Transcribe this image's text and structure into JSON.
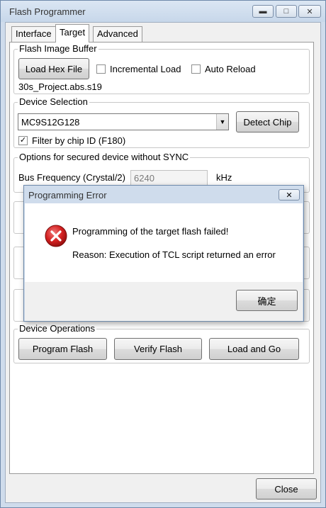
{
  "window": {
    "title": "Flash Programmer",
    "min_icon": "minimize-icon",
    "max_icon": "maximize-icon",
    "close_icon": "close-icon"
  },
  "tabs": [
    "Interface",
    "Target",
    "Advanced"
  ],
  "active_tab": "Target",
  "flash_image_buffer": {
    "title": "Flash Image Buffer",
    "load_hex_label": "Load Hex File",
    "incremental_load_label": "Incremental Load",
    "incremental_load_checked": false,
    "auto_reload_label": "Auto Reload",
    "auto_reload_checked": false,
    "file_name": "30s_Project.abs.s19"
  },
  "device_selection": {
    "title": "Device Selection",
    "selected_device": "MC9S12G128",
    "detect_chip_label": "Detect Chip",
    "filter_label": "Filter by chip ID (F180)",
    "filter_checked": true
  },
  "secured_options": {
    "title": "Options for secured device without SYNC",
    "bus_freq_label": "Bus Frequency (Crystal/2)",
    "bus_freq_value": "6240",
    "bus_freq_unit": "kHz"
  },
  "device_operations": {
    "title": "Device Operations",
    "program_flash_label": "Program Flash",
    "verify_flash_label": "Verify Flash",
    "load_and_go_label": "Load and Go"
  },
  "close_label": "Close",
  "error_dialog": {
    "title": "Programming Error",
    "close_icon": "close-icon",
    "icon": "error-icon",
    "message": "Programming of the target flash failed!",
    "reason": "Reason: Execution of TCL script returned an error",
    "ok_label": "确定"
  },
  "colors": {
    "frame": "#cfdcec",
    "error_red": "#d42020"
  }
}
